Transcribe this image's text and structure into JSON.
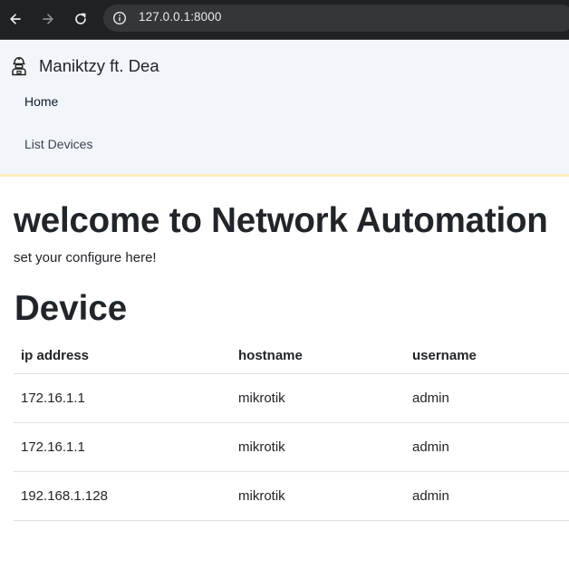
{
  "browser": {
    "url": "127.0.0.1:8000",
    "icons": {
      "back": "arrow-left-icon",
      "forward": "arrow-right-icon",
      "reload": "reload-icon",
      "site_info": "info-icon"
    }
  },
  "navbar": {
    "brand": "Maniktzy ft. Dea",
    "brand_icon": "robot-icon",
    "links": [
      {
        "label": "Home"
      },
      {
        "label": "List Devices"
      }
    ],
    "accent_color": "#fcefb8",
    "background_color": "#f2f6fa"
  },
  "main": {
    "title": "welcome to Network Automation",
    "subtitle": "set your configure here!",
    "section_heading": "Device",
    "table": {
      "headers": [
        "ip address",
        "hostname",
        "username"
      ],
      "rows": [
        [
          "172.16.1.1",
          "mikrotik",
          "admin"
        ],
        [
          "172.16.1.1",
          "mikrotik",
          "admin"
        ],
        [
          "192.168.1.128",
          "mikrotik",
          "admin"
        ]
      ]
    }
  }
}
